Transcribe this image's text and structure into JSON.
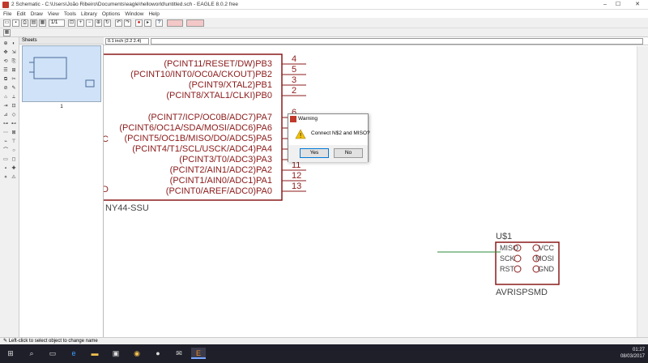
{
  "window": {
    "title": "2 Schematic - C:\\Users\\João Ribeiro\\Documents\\eagle\\helloworld\\untitled.sch - EAGLE 8.0.2 free",
    "minimize": "–",
    "maximize": "☐",
    "close": "✕"
  },
  "menu": [
    "File",
    "Edit",
    "Draw",
    "View",
    "Tools",
    "Library",
    "Options",
    "Window",
    "Help"
  ],
  "toolbar": {
    "sheet_select": "1/1",
    "icons": [
      "open-icon",
      "save-icon",
      "print-icon",
      "cam-icon",
      "board-icon",
      "sheet-select",
      "zoom-fit-icon",
      "zoom-in-icon",
      "zoom-out-icon",
      "zoom-select-icon",
      "redraw-icon",
      "undo-icon",
      "redo-icon",
      "stop-icon",
      "go-icon",
      "help-icon",
      "fusion-icon",
      "design-link-icon"
    ]
  },
  "sheets_panel": {
    "title": "Sheets",
    "sheet_number": "1"
  },
  "coordinates": "0.1 inch (2.2 2.4)",
  "schematic": {
    "pins_top": [
      {
        "label": "(PCINT11/RESET/DW)PB3",
        "num": "4"
      },
      {
        "label": "(PCINT10/INT0/OC0A/CKOUT)PB2",
        "num": "5"
      },
      {
        "label": "(PCINT9/XTAL2)PB1",
        "num": "3"
      },
      {
        "label": "(PCINT8/XTAL1/CLKI)PB0",
        "num": "2"
      }
    ],
    "pins_bottom": [
      {
        "label": "(PCINT7/ICP/OC0B/ADC7)PA7",
        "num": "6"
      },
      {
        "label": "(PCINT6/OC1A/SDA/MOSI/ADC6)PA6",
        "num": "7"
      },
      {
        "label": "(PCINT5/OC1B/MISO/DO/ADC5)PA5",
        "num": "8"
      },
      {
        "label": "(PCINT4/T1/SCL/USCK/ADC4)PA4",
        "num": "9"
      },
      {
        "label": "(PCINT3/T0/ADC3)PA3",
        "num": "10"
      },
      {
        "label": "(PCINT2/AIN1/ADC2)PA2",
        "num": "11"
      },
      {
        "label": "(PCINT1/AIN0/ADC1)PA1",
        "num": "12"
      },
      {
        "label": "(PCINT0/AREF/ADC0)PA0",
        "num": "13"
      }
    ],
    "left_fragment_1": "C",
    "left_fragment_2": "D",
    "chip_name": "NY44-SSU",
    "avr_ref": "U$1",
    "avr_name": "AVRISPSMD",
    "avr_pins_left": [
      "MISO",
      "SCK",
      "RST"
    ],
    "avr_pins_right": [
      "VCC",
      "MOSI",
      "GND"
    ]
  },
  "dialog": {
    "title": "Warning",
    "message": "Connect N$2 and MISO?",
    "yes": "Yes",
    "no": "No"
  },
  "status": "Left-click to select object to change name",
  "taskbar": {
    "apps": [
      "windows-start-icon",
      "search-icon",
      "task-view-icon",
      "edge-icon",
      "file-explorer-icon",
      "store-icon",
      "chrome-icon",
      "github-icon",
      "mail-icon",
      "eagle-icon"
    ],
    "time": "01:27",
    "date": "08/03/2017"
  },
  "colors": {
    "pin_color": "#8b1a1a",
    "wire_color": "#2e8b3d",
    "thumb_bg": "#cfe2f7",
    "taskbar_bg": "#1f1f2a"
  }
}
